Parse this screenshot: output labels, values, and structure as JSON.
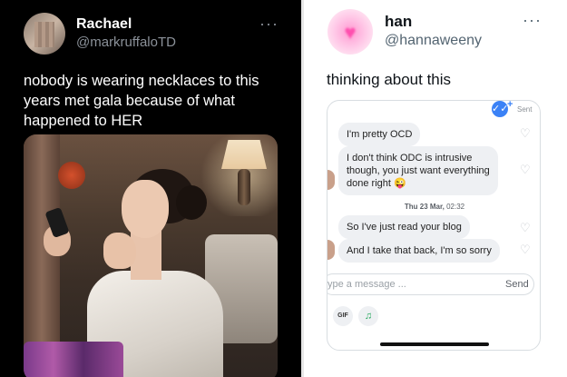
{
  "left_tweet": {
    "name": "Rachael",
    "handle": "@markruffaloTD",
    "more": "···",
    "text": "nobody is wearing necklaces to this years met gala because of what happened to HER"
  },
  "right_tweet": {
    "name": "han",
    "handle": "@hannaweeny",
    "more": "···",
    "text": "thinking about this",
    "screenshot": {
      "status": "Sent",
      "check_glyph": "✓✓",
      "plus": "+",
      "messages": [
        {
          "text": "I'm pretty OCD"
        },
        {
          "text": "I don't think ODC is intrusive though, you just want everything done right 😜"
        },
        {
          "text": "So I've just read your blog"
        },
        {
          "text": "And I take that back, I'm so sorry"
        }
      ],
      "timestamp_day": "Thu 23 Mar,",
      "timestamp_time": "02:32",
      "input_placeholder": "ype a message ...",
      "send_label": "Send",
      "gif_label": "GIF",
      "music_glyph": "♫"
    }
  },
  "colors": {
    "left_bg": "#000000",
    "accent_blue": "#3b82f6",
    "avatar_pink": "#ff9ad2"
  },
  "icons": [
    "more-dots-icon",
    "read-check-icon",
    "heart-outline-icon",
    "music-note-icon",
    "gif-icon",
    "heart-avatar-icon"
  ]
}
